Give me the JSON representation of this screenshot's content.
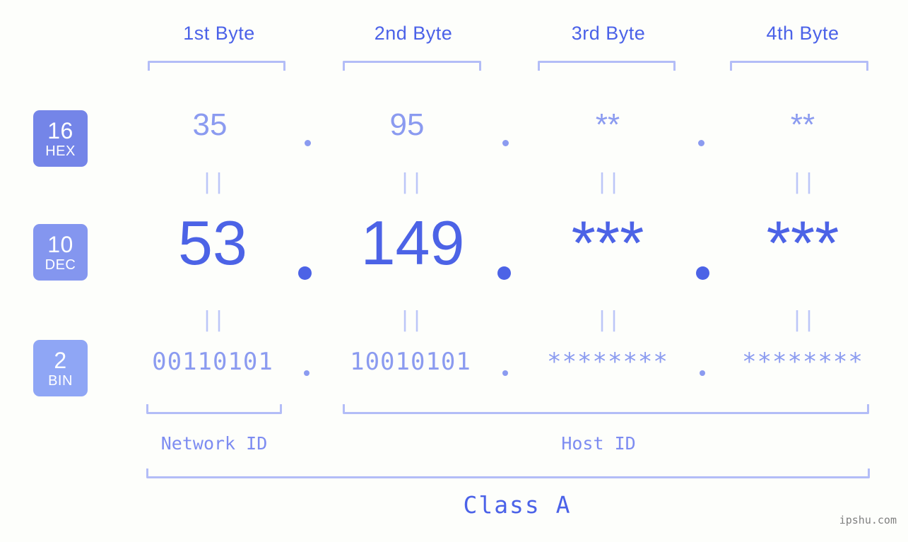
{
  "background_color": "#fdfefb",
  "colors": {
    "bracket": "#b3bdf7",
    "header_text": "#4b62e8",
    "hex_text": "#8b9bf0",
    "dec_text": "#4c63e6",
    "bin_text": "#8b9bf0",
    "equals": "#bcc6f8",
    "badge_hex": "#7485e8",
    "badge_dec": "#8496ef",
    "badge_bin": "#8fa6f5",
    "watermark": "#808080"
  },
  "byte_headers": [
    {
      "label": "1st Byte"
    },
    {
      "label": "2nd Byte"
    },
    {
      "label": "3rd Byte"
    },
    {
      "label": "4th Byte"
    }
  ],
  "bases": [
    {
      "number": "16",
      "name": "HEX"
    },
    {
      "number": "10",
      "name": "DEC"
    },
    {
      "number": "2",
      "name": "BIN"
    }
  ],
  "rows": {
    "hex": {
      "base_number": "16",
      "base_name": "HEX",
      "values": [
        "35",
        "95",
        "**",
        "**"
      ],
      "separator": "."
    },
    "dec": {
      "base_number": "10",
      "base_name": "DEC",
      "values": [
        "53",
        "149",
        "***",
        "***"
      ],
      "separator": "."
    },
    "bin": {
      "base_number": "2",
      "base_name": "BIN",
      "values": [
        "00110101",
        "10010101",
        "********",
        "********"
      ],
      "separator": "."
    }
  },
  "equals_symbol": "||",
  "sections": {
    "network_id": "Network ID",
    "host_id": "Host ID",
    "class": "Class A"
  },
  "watermark": "ipshu.com",
  "chart_data": {
    "type": "table",
    "title": "IP Address Byte Breakdown - Class A",
    "columns": [
      "1st Byte",
      "2nd Byte",
      "3rd Byte",
      "4th Byte"
    ],
    "rows": [
      {
        "base": "16",
        "base_name": "HEX",
        "cells": [
          "35",
          "95",
          "**",
          "**"
        ]
      },
      {
        "base": "10",
        "base_name": "DEC",
        "cells": [
          "53",
          "149",
          "***",
          "***"
        ]
      },
      {
        "base": "2",
        "base_name": "BIN",
        "cells": [
          "00110101",
          "10010101",
          "********",
          "********"
        ]
      }
    ],
    "annotations": {
      "network_id_span": [
        "1st Byte"
      ],
      "host_id_span": [
        "2nd Byte",
        "3rd Byte",
        "4th Byte"
      ],
      "class_span": [
        "1st Byte",
        "2nd Byte",
        "3rd Byte",
        "4th Byte"
      ]
    }
  }
}
